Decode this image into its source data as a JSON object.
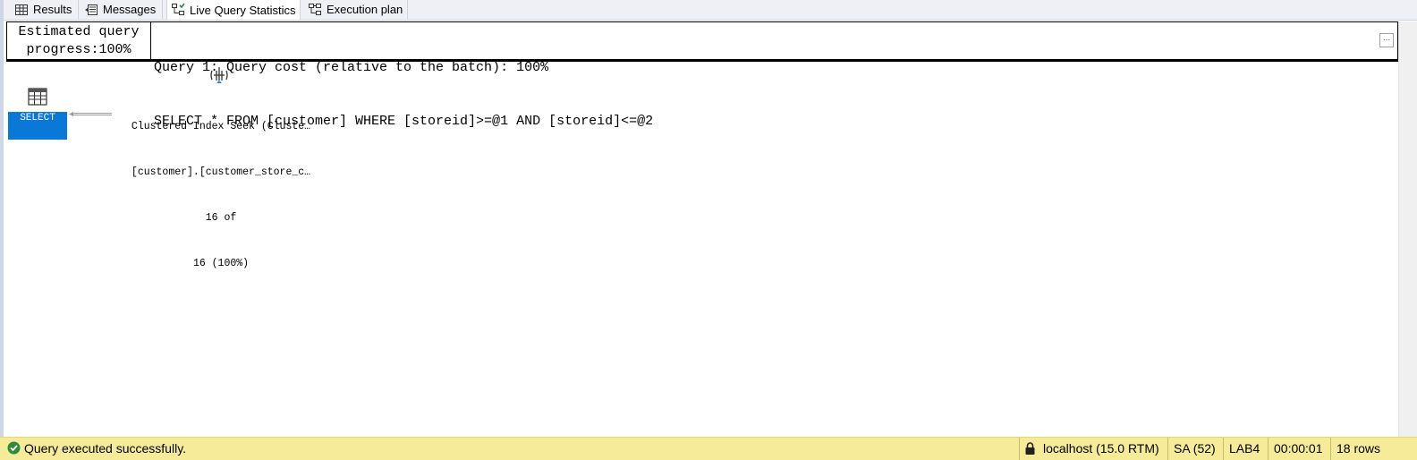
{
  "tabs": [
    {
      "label": "Results",
      "icon": "grid-icon"
    },
    {
      "label": "Messages",
      "icon": "messages-icon"
    },
    {
      "label": "Live Query Statistics",
      "icon": "live-stats-icon",
      "active": true
    },
    {
      "label": "Execution plan",
      "icon": "plan-icon"
    }
  ],
  "header": {
    "progress_line1": "Estimated query",
    "progress_line2": "progress:100%",
    "query_line1": "Query 1: Query cost (relative to the batch): 100%",
    "query_line2": "SELECT * FROM [customer] WHERE [storeid]>=@1 AND [storeid]<=@2",
    "expand_label": "..."
  },
  "plan": {
    "select_label": "SELECT",
    "seek_line1": "Clustered Index Seek (Cluste…",
    "seek_line2": "[customer].[customer_store_c…",
    "seek_line3": "16 of",
    "seek_line4": "16 (100%)"
  },
  "status": {
    "message": "Query executed successfully.",
    "server": "localhost (15.0 RTM)",
    "user": "SA (52)",
    "database": "LAB4",
    "elapsed": "00:00:01",
    "rows": "18 rows"
  },
  "colors": {
    "select_node": "#0a78d7",
    "status_bar": "#f5eb99",
    "success_icon": "#2e8b3d"
  }
}
